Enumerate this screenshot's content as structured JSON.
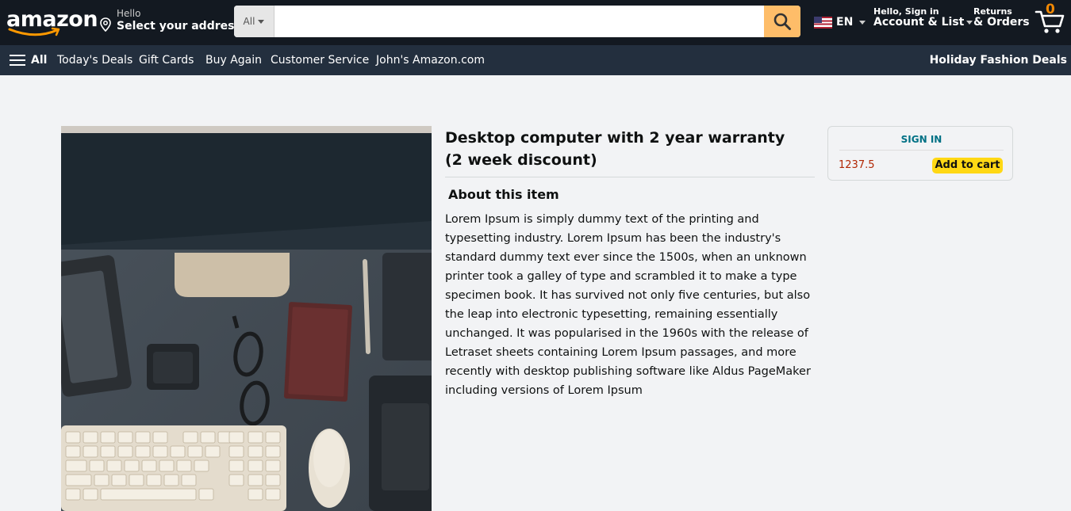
{
  "header": {
    "logo_text": "amazon",
    "address": {
      "greeting": "Hello",
      "label": "Select your address"
    },
    "search": {
      "category": "All",
      "value": "",
      "placeholder": ""
    },
    "language": "EN",
    "account": {
      "greeting": "Hello, Sign in",
      "label": "Account & List"
    },
    "orders": {
      "line1": "Returns",
      "line2": "& Orders"
    },
    "cart_count": "0"
  },
  "subnav": {
    "all_label": "All",
    "items": [
      "Today's Deals",
      "Gift Cards",
      "Buy Again",
      "Customer Service",
      "John's Amazon.com"
    ],
    "promo": "Holiday Fashion Deals"
  },
  "product": {
    "title": "Desktop computer with 2 year warranty (2 week discount)",
    "about_heading": "About this item",
    "description": "Lorem Ipsum is simply dummy text of the printing and typesetting industry. Lorem Ipsum has been the industry's standard dummy text ever since the 1500s, when an unknown printer took a galley of type and scrambled it to make a type specimen book. It has survived not only five centuries, but also the leap into electronic typesetting, remaining essentially unchanged. It was popularised in the 1960s with the release of Letraset sheets containing Lorem Ipsum passages, and more recently with desktop publishing software like Aldus PageMaker including versions of Lorem Ipsum"
  },
  "buybox": {
    "signin_label": "SIGN IN",
    "price": "1237.5",
    "add_to_cart_label": "Add to cart"
  },
  "colors": {
    "nav_bg": "#131921",
    "subnav_bg": "#232f3e",
    "search_button": "#febd69",
    "add_to_cart": "#ffd814",
    "price": "#b12704",
    "link": "#007185"
  }
}
